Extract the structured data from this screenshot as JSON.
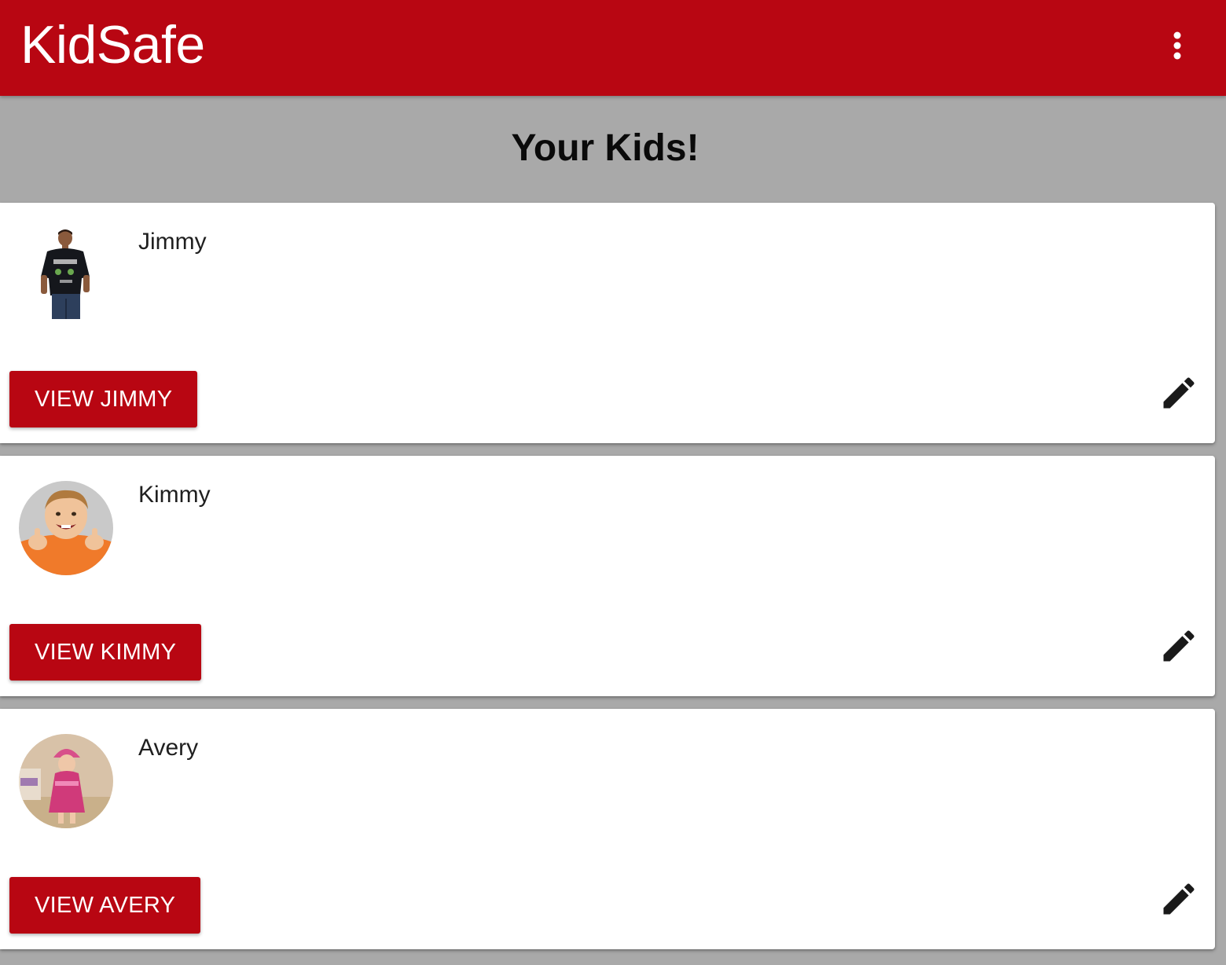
{
  "app": {
    "title": "KidSafe",
    "menu_icon": "more-vert-icon",
    "brand_color": "#b80612"
  },
  "page": {
    "title": "Your Kids!"
  },
  "kids": [
    {
      "name": "Jimmy",
      "button_label": "VIEW JIMMY",
      "avatar": "kid-photo-boy-black-tshirt",
      "edit_icon": "pencil-icon"
    },
    {
      "name": "Kimmy",
      "button_label": "VIEW KIMMY",
      "avatar": "kid-photo-boy-thumbs-up-orange-shirt",
      "edit_icon": "pencil-icon"
    },
    {
      "name": "Avery",
      "button_label": "VIEW AVERY",
      "avatar": "kid-photo-girl-pink-costume",
      "edit_icon": "pencil-icon"
    }
  ]
}
